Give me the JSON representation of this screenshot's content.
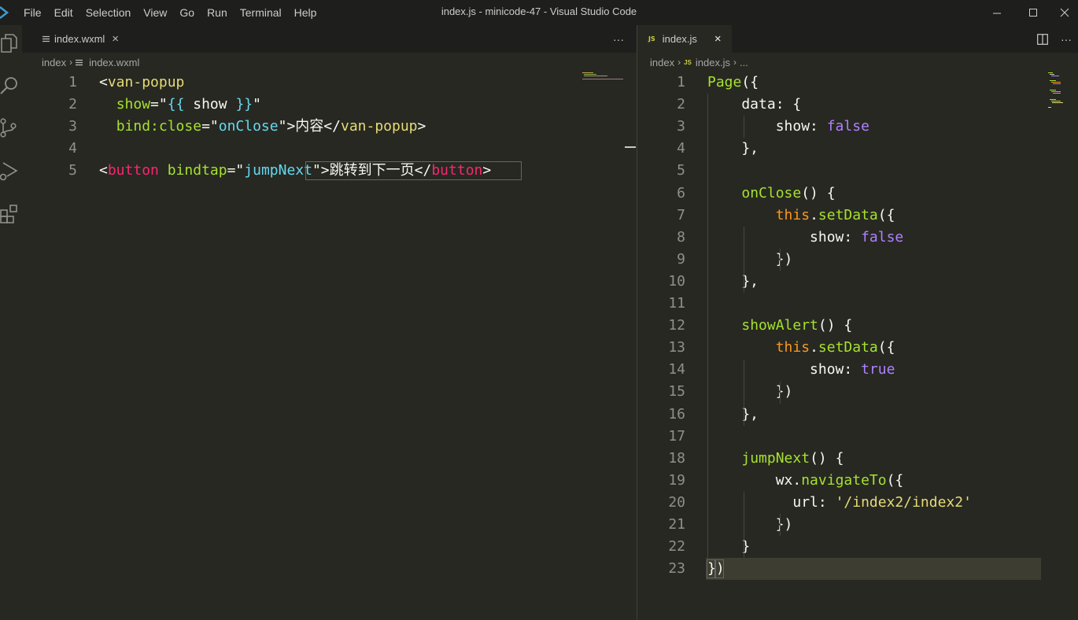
{
  "window": {
    "title": "index.js - minicode-47 - Visual Studio Code",
    "menu": [
      "File",
      "Edit",
      "Selection",
      "View",
      "Go",
      "Run",
      "Terminal",
      "Help"
    ]
  },
  "activity_icons": [
    "explorer-icon",
    "search-icon",
    "source-control-icon",
    "run-debug-icon",
    "extensions-icon"
  ],
  "left_editor": {
    "tab": {
      "label": "index.wxml",
      "close": "×"
    },
    "more": "···",
    "breadcrumb": [
      "index",
      "index.wxml"
    ],
    "lines": [
      {
        "n": "1",
        "tokens": [
          [
            "<",
            "t-plain"
          ],
          [
            "van-popup",
            "t-tagy"
          ]
        ]
      },
      {
        "n": "2",
        "tokens": [
          [
            "  ",
            "t-plain"
          ],
          [
            "show",
            "t-attr"
          ],
          [
            "=\"",
            "t-plain"
          ],
          [
            "{{ ",
            "t-bind"
          ],
          [
            "show",
            "t-plain"
          ],
          [
            " }}",
            "t-bind"
          ],
          [
            "\"",
            "t-plain"
          ]
        ]
      },
      {
        "n": "3",
        "tokens": [
          [
            "  ",
            "t-plain"
          ],
          [
            "bind:close",
            "t-attr"
          ],
          [
            "=\"",
            "t-plain"
          ],
          [
            "onClose",
            "t-bind"
          ],
          [
            "\">",
            "t-plain"
          ],
          [
            "内容",
            "t-plain"
          ],
          [
            "</",
            "t-plain"
          ],
          [
            "van-popup",
            "t-tagy"
          ],
          [
            ">",
            "t-plain"
          ]
        ]
      },
      {
        "n": "4",
        "tokens": []
      },
      {
        "n": "5",
        "tokens": [
          [
            "<",
            "t-plain"
          ],
          [
            "button",
            "t-tag"
          ],
          [
            " ",
            "t-plain"
          ],
          [
            "bindtap",
            "t-attr"
          ],
          [
            "=\"",
            "t-plain"
          ],
          [
            "jumpNext",
            "t-bind"
          ],
          [
            "\">",
            "t-plain"
          ],
          [
            "跳转到下一页",
            "t-plain"
          ],
          [
            "</",
            "t-plain"
          ],
          [
            "button",
            "t-tag"
          ],
          [
            ">",
            "t-plain"
          ]
        ]
      }
    ]
  },
  "right_editor": {
    "tab": {
      "badge": "JS",
      "label": "index.js",
      "close": "×"
    },
    "breadcrumb": [
      "index",
      "index.js",
      "..."
    ],
    "lines": [
      {
        "n": "1",
        "tokens": [
          [
            "Page",
            "t-fn"
          ],
          [
            "({",
            "t-plain"
          ]
        ]
      },
      {
        "n": "2",
        "tokens": [
          [
            "    data: {",
            "t-plain"
          ]
        ]
      },
      {
        "n": "3",
        "tokens": [
          [
            "        show: ",
            "t-plain"
          ],
          [
            "false",
            "t-bool"
          ]
        ]
      },
      {
        "n": "4",
        "tokens": [
          [
            "    },",
            "t-plain"
          ]
        ]
      },
      {
        "n": "5",
        "tokens": []
      },
      {
        "n": "6",
        "tokens": [
          [
            "    ",
            "t-plain"
          ],
          [
            "onClose",
            "t-fn"
          ],
          [
            "() {",
            "t-plain"
          ]
        ]
      },
      {
        "n": "7",
        "tokens": [
          [
            "        ",
            "t-plain"
          ],
          [
            "this",
            "t-kw"
          ],
          [
            ".",
            "t-plain"
          ],
          [
            "setData",
            "t-fn"
          ],
          [
            "({",
            "t-plain"
          ]
        ]
      },
      {
        "n": "8",
        "tokens": [
          [
            "            show: ",
            "t-plain"
          ],
          [
            "false",
            "t-bool"
          ]
        ]
      },
      {
        "n": "9",
        "tokens": [
          [
            "        })",
            "t-plain"
          ]
        ]
      },
      {
        "n": "10",
        "tokens": [
          [
            "    },",
            "t-plain"
          ]
        ]
      },
      {
        "n": "11",
        "tokens": []
      },
      {
        "n": "12",
        "tokens": [
          [
            "    ",
            "t-plain"
          ],
          [
            "showAlert",
            "t-fn"
          ],
          [
            "() {",
            "t-plain"
          ]
        ]
      },
      {
        "n": "13",
        "tokens": [
          [
            "        ",
            "t-plain"
          ],
          [
            "this",
            "t-kw"
          ],
          [
            ".",
            "t-plain"
          ],
          [
            "setData",
            "t-fn"
          ],
          [
            "({",
            "t-plain"
          ]
        ]
      },
      {
        "n": "14",
        "tokens": [
          [
            "            show: ",
            "t-plain"
          ],
          [
            "true",
            "t-bool"
          ]
        ]
      },
      {
        "n": "15",
        "tokens": [
          [
            "        })",
            "t-plain"
          ]
        ]
      },
      {
        "n": "16",
        "tokens": [
          [
            "    },",
            "t-plain"
          ]
        ]
      },
      {
        "n": "17",
        "tokens": []
      },
      {
        "n": "18",
        "tokens": [
          [
            "    ",
            "t-plain"
          ],
          [
            "jumpNext",
            "t-fn"
          ],
          [
            "() {",
            "t-plain"
          ]
        ]
      },
      {
        "n": "19",
        "tokens": [
          [
            "        wx.",
            "t-plain"
          ],
          [
            "navigateTo",
            "t-fn"
          ],
          [
            "({",
            "t-plain"
          ]
        ]
      },
      {
        "n": "20",
        "tokens": [
          [
            "          url: ",
            "t-plain"
          ],
          [
            "'/index2/index2'",
            "t-str"
          ]
        ]
      },
      {
        "n": "21",
        "tokens": [
          [
            "        })",
            "t-plain"
          ]
        ]
      },
      {
        "n": "22",
        "tokens": [
          [
            "    }",
            "t-plain"
          ]
        ]
      },
      {
        "n": "23",
        "tokens": [
          [
            "})",
            "t-plain"
          ]
        ]
      }
    ]
  },
  "colors": {
    "background": "#272822",
    "tabstrip": "#1e1f1c",
    "current_line": "#3e3d32"
  }
}
